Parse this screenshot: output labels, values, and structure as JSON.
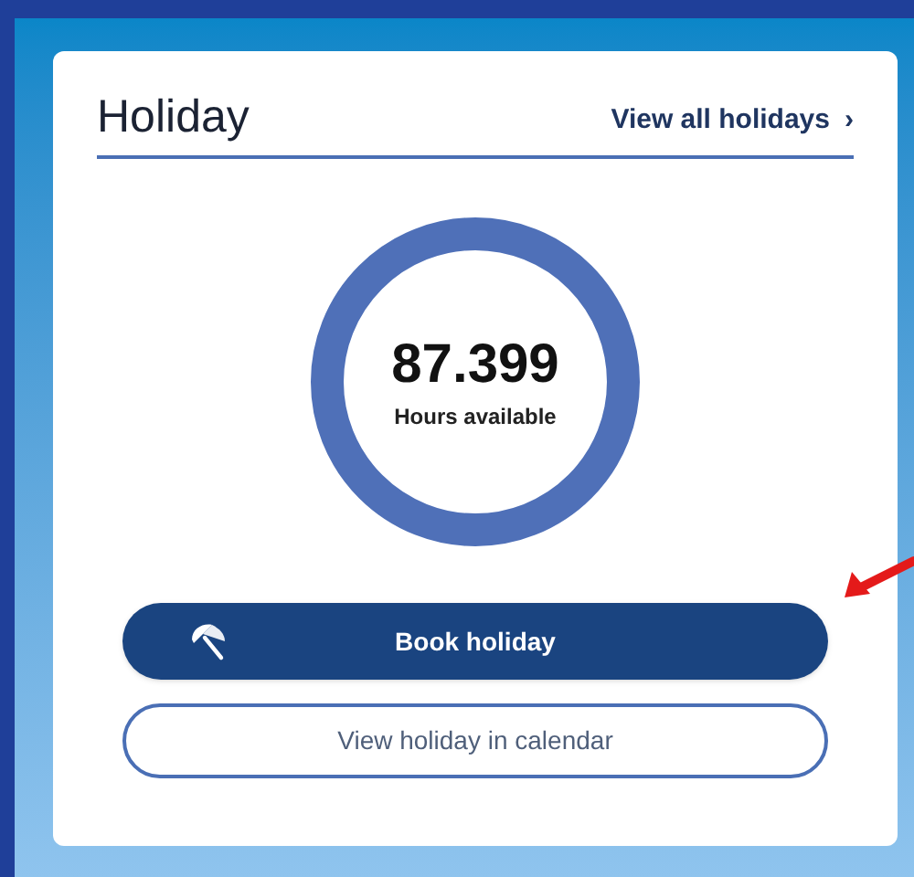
{
  "card": {
    "title": "Holiday",
    "link": {
      "label": "View all holidays",
      "chevron": "›"
    }
  },
  "balance": {
    "value": "87.399",
    "caption": "Hours available"
  },
  "buttons": [
    {
      "label": "Book holiday",
      "kind": "primary"
    },
    {
      "label": "View holiday in calendar",
      "kind": "outline"
    }
  ]
}
